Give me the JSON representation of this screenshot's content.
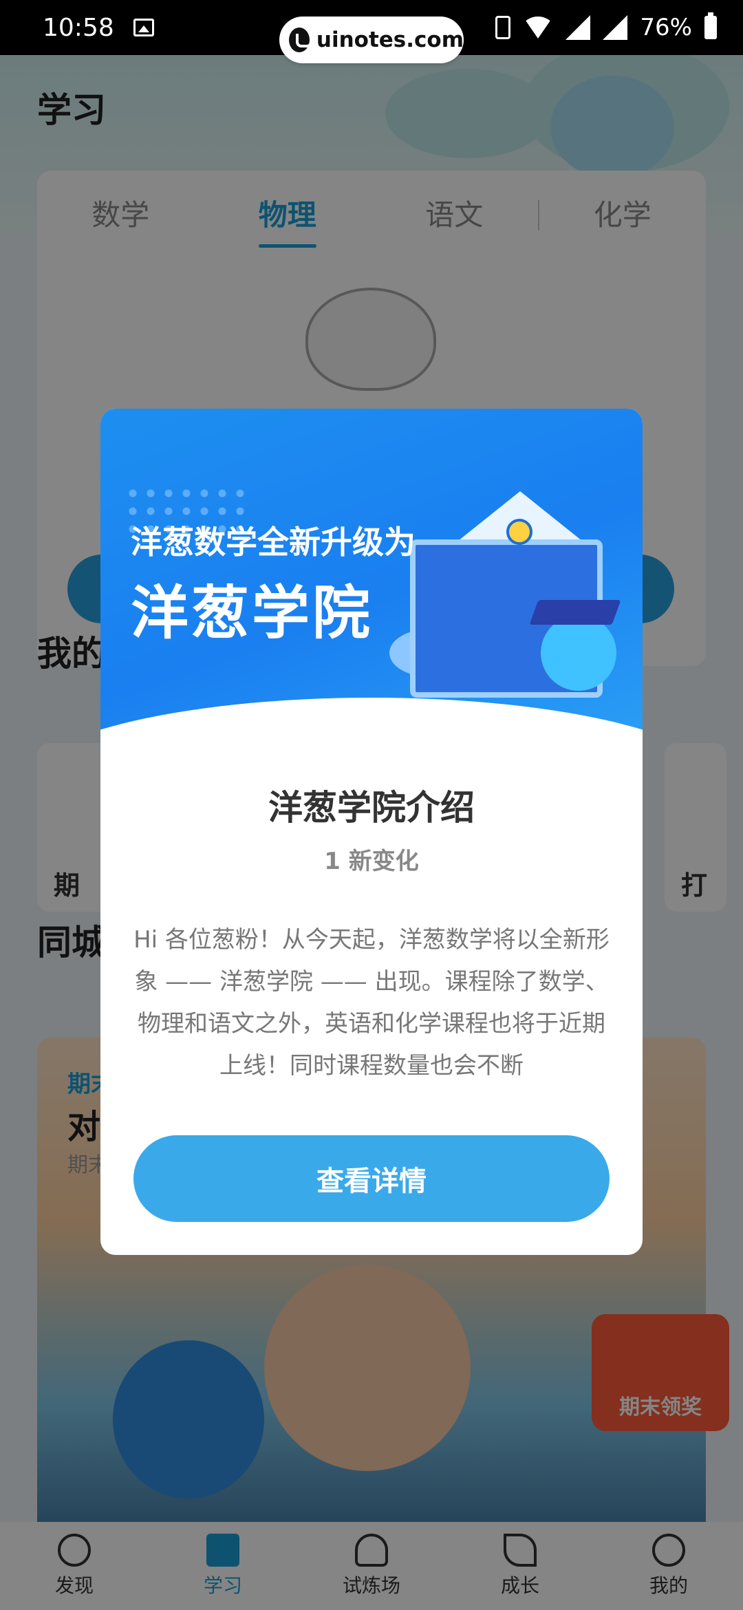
{
  "status_bar": {
    "time": "10:58",
    "battery": "76%"
  },
  "watermark": {
    "text": "uinotes.com"
  },
  "page": {
    "title": "学习",
    "tabs": [
      {
        "label": "数学"
      },
      {
        "label": "物理"
      },
      {
        "label": "语文"
      },
      {
        "label": "化学"
      }
    ],
    "my_section_title": "我的",
    "card_left_label": "期",
    "card_right_label": "打",
    "city_section_title": "同城",
    "banner": {
      "tag": "期末",
      "title": "对",
      "sub": "期末"
    },
    "reward_badge": "期末领奖"
  },
  "bottom_nav": [
    {
      "label": "发现",
      "icon": "compass-icon"
    },
    {
      "label": "学习",
      "icon": "books-icon"
    },
    {
      "label": "试炼场",
      "icon": "bell-icon"
    },
    {
      "label": "成长",
      "icon": "leaf-icon"
    },
    {
      "label": "我的",
      "icon": "profile-icon"
    }
  ],
  "dialog": {
    "hero_subtitle": "洋葱数学全新升级为",
    "hero_title": "洋葱学院",
    "title": "洋葱学院介绍",
    "count": "1 新变化",
    "body": "Hi 各位葱粉！从今天起，洋葱数学将以全新形象 —— 洋葱学院 —— 出现。课程除了数学、物理和语文之外，英语和化学课程也将于近期上线！同时课程数量也会不断",
    "button": "查看详情"
  },
  "colors": {
    "accent": "#1a9fd6",
    "button": "#3aa9ea",
    "hero": "#1a7ff0"
  }
}
